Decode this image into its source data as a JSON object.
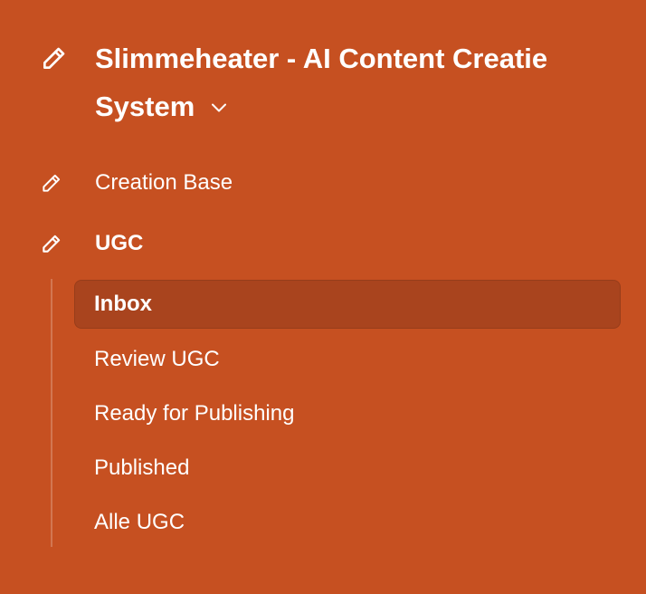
{
  "workspace": {
    "title": "Slimmeheater - AI Content Creatie System",
    "icon": "pencil-icon",
    "dropdown_icon": "chevron-down-icon"
  },
  "nav": {
    "items": [
      {
        "label": "Creation Base",
        "icon": "pencil-icon"
      },
      {
        "label": "UGC",
        "icon": "pencil-icon",
        "active": true
      }
    ]
  },
  "ugc": {
    "items": [
      {
        "label": "Inbox",
        "active": true
      },
      {
        "label": "Review UGC"
      },
      {
        "label": "Ready for Publishing"
      },
      {
        "label": "Published"
      },
      {
        "label": "Alle UGC"
      }
    ]
  },
  "colors": {
    "background": "#C65021",
    "active_bg": "#A9441E",
    "text": "#FFFFFF"
  }
}
